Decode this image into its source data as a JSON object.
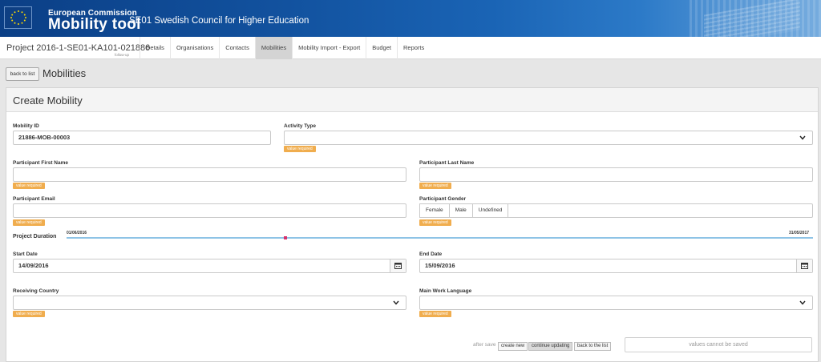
{
  "header": {
    "commission": "European Commission",
    "app_name": "Mobility tool",
    "organisation": "SE01 Swedish Council for Higher Education"
  },
  "nav": {
    "project": "Project 2016-1-SE01-KA101-021886",
    "project_sub": "follow-up",
    "tabs": [
      "Details",
      "Organisations",
      "Contacts",
      "Mobilities",
      "Mobility Import - Export",
      "Budget",
      "Reports"
    ],
    "active_tab": "Mobilities"
  },
  "page": {
    "back_label": "back to list",
    "title": "Mobilities",
    "panel_title": "Create Mobility"
  },
  "form": {
    "mobility_id": {
      "label": "Mobility ID",
      "value": "21886-MOB-00003"
    },
    "activity_type": {
      "label": "Activity Type",
      "value": ""
    },
    "first_name": {
      "label": "Participant First Name",
      "value": ""
    },
    "last_name": {
      "label": "Participant Last Name",
      "value": ""
    },
    "email": {
      "label": "Participant Email",
      "value": ""
    },
    "gender": {
      "label": "Participant Gender",
      "options": [
        "Female",
        "Male",
        "Undefined"
      ]
    },
    "duration": {
      "label": "Project Duration",
      "start": "01/06/2016",
      "end": "31/05/2017"
    },
    "start_date": {
      "label": "Start Date",
      "value": "14/09/2016"
    },
    "end_date": {
      "label": "End Date",
      "value": "15/09/2016"
    },
    "receiving_country": {
      "label": "Receiving Country",
      "value": ""
    },
    "work_language": {
      "label": "Main Work Language",
      "value": ""
    },
    "required_text": "value required"
  },
  "footer": {
    "after_save": "after save",
    "create_new": "create new",
    "continue_updating": "continue updating",
    "back_to_list": "back to the list",
    "save_status": "values cannot be saved"
  },
  "colors": {
    "banner": "#12529f",
    "required": "#f0ad4e",
    "timeline": "#8ec3e6",
    "timeline_marker": "#d6336c"
  }
}
